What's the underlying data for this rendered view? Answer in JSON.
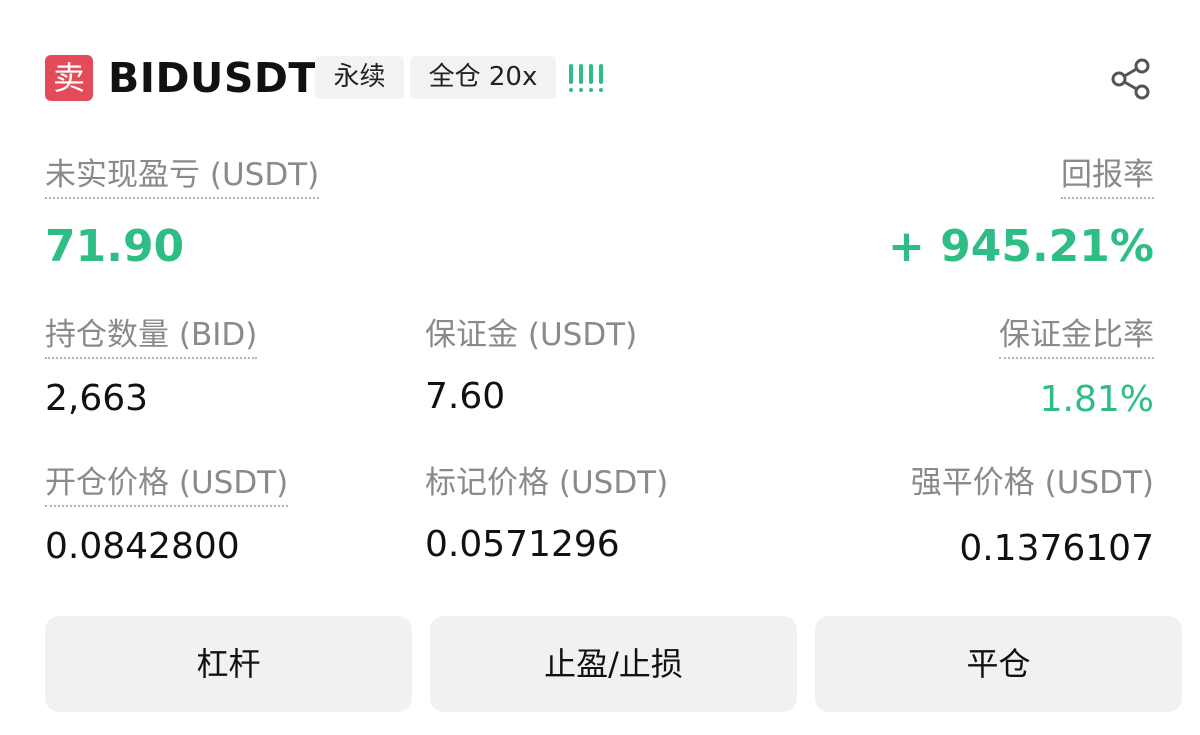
{
  "header": {
    "side": "卖",
    "symbol": "BIDUSDT",
    "contract_type": "永续",
    "margin_mode": "全仓 20x",
    "side_color": "#e34b59",
    "strength_icon": "signal-bars-icon",
    "share_icon": "share-icon"
  },
  "pnl": {
    "label": "未实现盈亏 (USDT)",
    "value": "71.90",
    "roe_label": "回报率",
    "roe_value": "+ 945.21%"
  },
  "row1": {
    "qty_label": "持仓数量 (BID)",
    "qty_value": "2,663",
    "margin_label": "保证金 (USDT)",
    "margin_value": "7.60",
    "margin_ratio_label": "保证金比率",
    "margin_ratio_value": "1.81%"
  },
  "row2": {
    "entry_label": "开仓价格 (USDT)",
    "entry_value": "0.0842800",
    "mark_label": "标记价格 (USDT)",
    "mark_value": "0.0571296",
    "liq_label": "强平价格 (USDT)",
    "liq_value": "0.1376107"
  },
  "buttons": {
    "leverage": "杠杆",
    "tpsl": "止盈/止损",
    "close": "平仓"
  },
  "colors": {
    "profit": "#2ebd85",
    "sell": "#e34b59"
  }
}
